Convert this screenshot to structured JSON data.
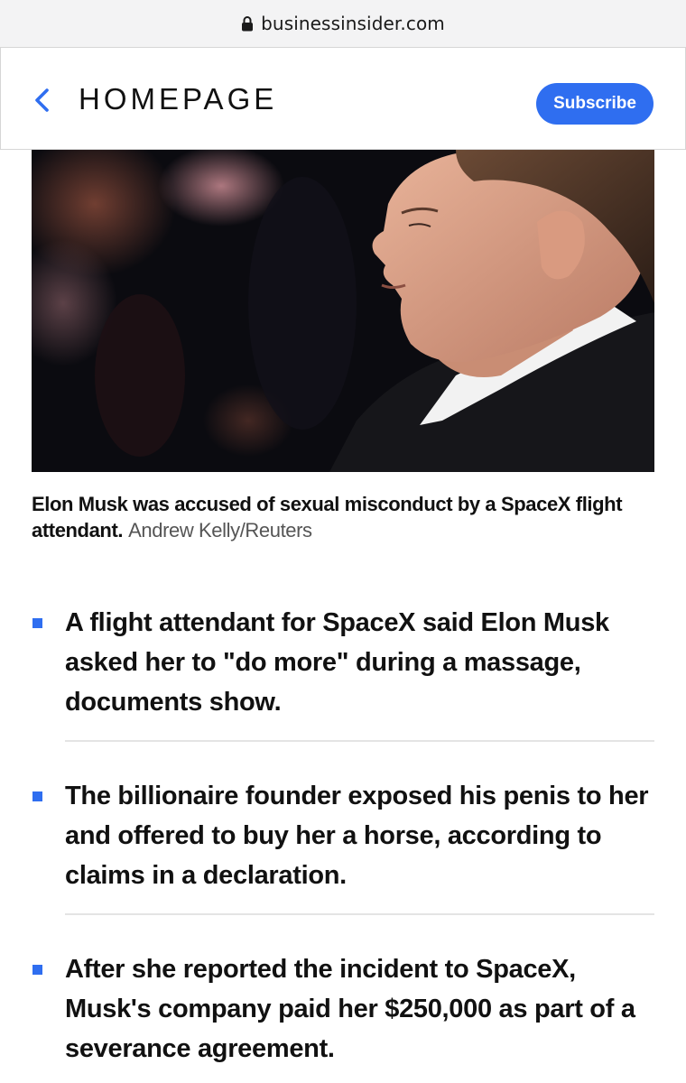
{
  "browser": {
    "url": "businessinsider.com",
    "lock_icon": "lock-icon"
  },
  "header": {
    "back_icon": "chevron-left-icon",
    "homepage_label": "HOMEPAGE",
    "subscribe_label": "Subscribe",
    "accent_color": "#2f6ef0"
  },
  "article": {
    "hero_image_alt": "",
    "caption": "Elon Musk was accused of sexual misconduct by a SpaceX flight attendant.",
    "credit": "Andrew Kelly/Reuters",
    "bullets": [
      "A flight attendant for SpaceX said Elon Musk asked her to \"do more\" during a massage, documents show.",
      "The billionaire founder exposed his penis to her and offered to buy her a horse, according to claims in a declaration.",
      "After she reported the incident to SpaceX, Musk's company paid her $250,000 as part of a severance agreement."
    ]
  }
}
